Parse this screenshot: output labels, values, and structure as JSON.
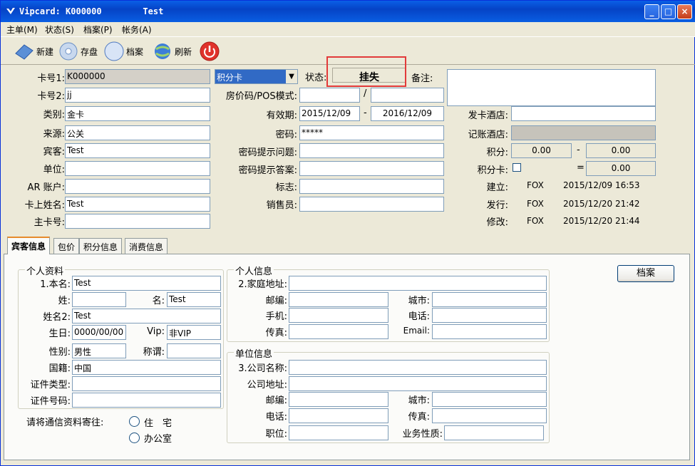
{
  "window": {
    "title": "Vipcard: K000000        Test",
    "min_label": "_",
    "max_label": "□",
    "close_label": "×"
  },
  "menu": [
    "主单(M)",
    "状态(S)",
    "档案(P)",
    "帐务(A)"
  ],
  "toolbar": {
    "new": "新建",
    "save": "存盘",
    "profile": "档案",
    "refresh": "刷新"
  },
  "card": {
    "no_label": "卡号1:",
    "no": "K000000",
    "no2_label": "卡号2:",
    "no2": "jj",
    "type_label": "类别:",
    "type": "金卡",
    "source_label": "来源:",
    "source": "公关",
    "guest_label": "宾客:",
    "guest": "Test",
    "unit_label": "单位:",
    "unit": "",
    "ar_label": "AR 账户:",
    "ar": "",
    "name_label": "卡上姓名:",
    "name": "Test",
    "main_label": "主卡号:",
    "main": "",
    "kind_select": "积分卡",
    "status_label": "状态:",
    "status": "挂失",
    "note_label": "备注:",
    "note": "",
    "rate_label": "房价码/POS模式:",
    "rate_sep": "/",
    "valid_label": "有效期:",
    "valid_from": "2015/12/09",
    "valid_dash": "-",
    "valid_to": "2016/12/09",
    "pwd_label": "密码:",
    "pwd": "*****",
    "q_label": "密码提示问题:",
    "a_label": "密码提示答案:",
    "flag_label": "标志:",
    "sales_label": "销售员:",
    "issue_hotel_label": "发卡酒店:",
    "acct_hotel_label": "记账酒店:",
    "points_label": "积分:",
    "points_a": "0.00",
    "points_dash": "-",
    "points_b": "0.00",
    "pcard_label": "积分卡:",
    "pcard_eq": "=",
    "pcard_val": "0.00",
    "created_label": "建立:",
    "created_by": "FOX",
    "created_at": "2015/12/09 16:53",
    "issued_label": "发行:",
    "issued_by": "FOX",
    "issued_at": "2015/12/20 21:42",
    "modified_label": "修改:",
    "modified_by": "FOX",
    "modified_at": "2015/12/20 21:44"
  },
  "tabs": [
    "宾客信息",
    "包价",
    "积分信息",
    "消费信息"
  ],
  "personal": {
    "title": "个人资料",
    "name_label": "1.本名:",
    "name": "Test",
    "last_label": "姓:",
    "last": "",
    "first_label": "名:",
    "first": "Test",
    "name2_label": "姓名2:",
    "name2": "Test",
    "birth_label": "生日:",
    "birth": "0000/00/00",
    "vip_label": "Vip:",
    "vip": "非VIP",
    "sex_label": "性别:",
    "sex": "男性",
    "title_label": "称谓:",
    "title_val": "",
    "nation_label": "国籍:",
    "nation": "中国",
    "idtype_label": "证件类型:",
    "idno_label": "证件号码:",
    "mail_prompt": "请将通信资料寄往:",
    "home_opt": "住　宅",
    "office_opt": "办公室"
  },
  "privateinfo": {
    "title": "个人信息",
    "addr_label": "2.家庭地址:",
    "zip_label": "邮编:",
    "city_label": "城市:",
    "mobile_label": "手机:",
    "phone_label": "电话:",
    "fax_label": "传真:",
    "email_label": "Email:"
  },
  "company": {
    "title": "单位信息",
    "name_label": "3.公司名称:",
    "addr_label": "公司地址:",
    "zip_label": "邮编:",
    "city_label": "城市:",
    "phone_label": "电话:",
    "fax_label": "传真:",
    "job_label": "职位:",
    "biz_label": "业务性质:"
  },
  "profile_button": "档案"
}
